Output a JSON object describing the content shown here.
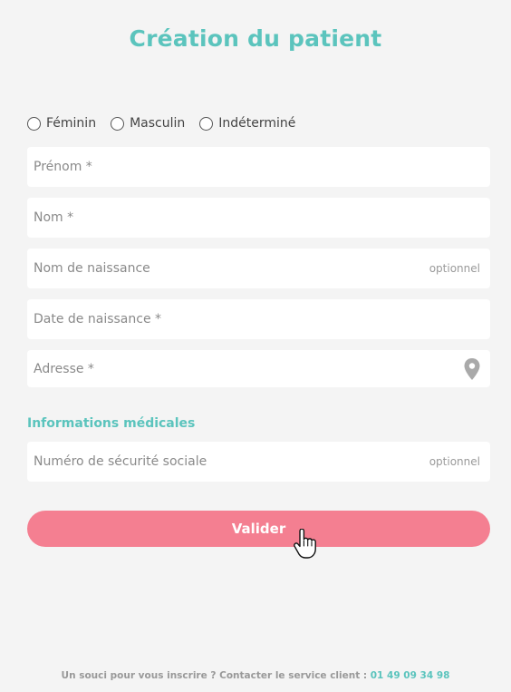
{
  "header": {
    "title": "Création du patient"
  },
  "gender": {
    "options": [
      "Féminin",
      "Masculin",
      "Indéterminé"
    ]
  },
  "fields": {
    "first_name": {
      "placeholder": "Prénom *"
    },
    "last_name": {
      "placeholder": "Nom *"
    },
    "birth_name": {
      "placeholder": "Nom de naissance",
      "optional": "optionnel"
    },
    "birth_date": {
      "placeholder": "Date de naissance *"
    },
    "address": {
      "placeholder": "Adresse *",
      "icon": "location-pin-icon"
    }
  },
  "medical": {
    "section_title": "Informations médicales",
    "social_security": {
      "placeholder": "Numéro de sécurité sociale",
      "optional": "optionnel"
    }
  },
  "actions": {
    "submit_label": "Valider"
  },
  "footer": {
    "text": "Un souci pour vous inscrire ? Contacter le service client :",
    "phone": "01 49 09 34 98"
  },
  "colors": {
    "accent": "#5bc4bd",
    "button": "#f47f91",
    "background": "#f4f4f4"
  }
}
